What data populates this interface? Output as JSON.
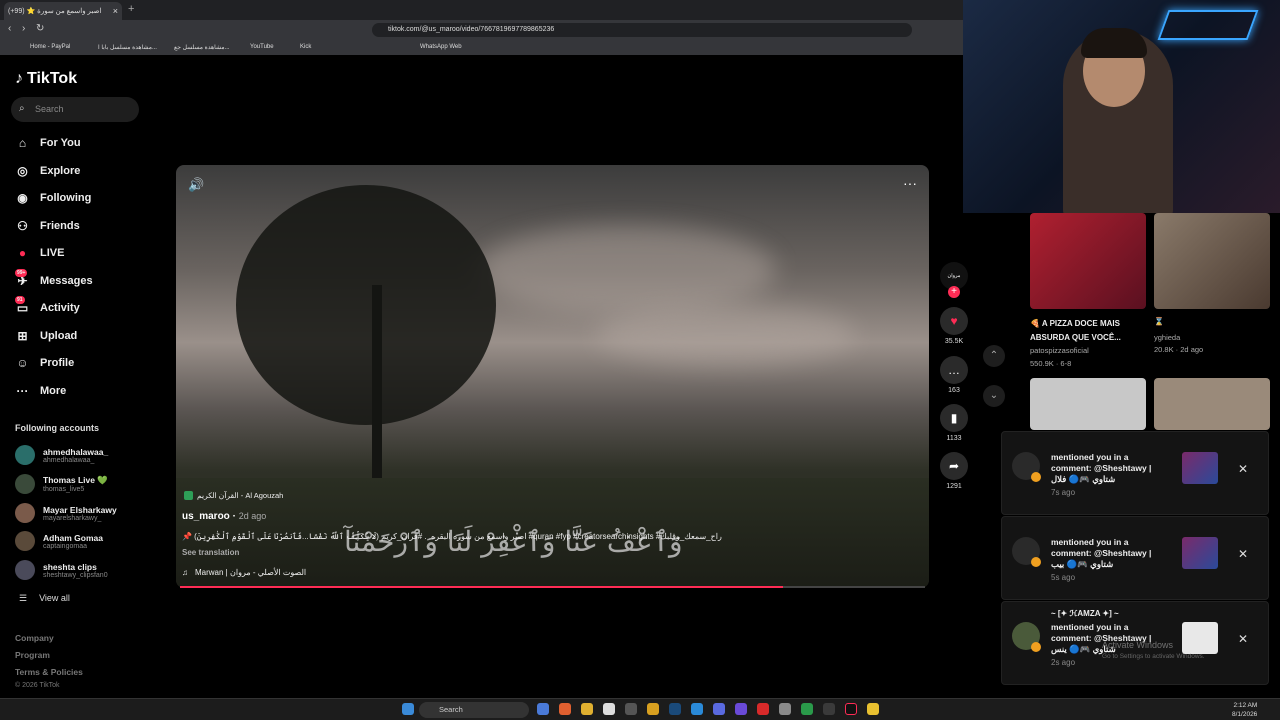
{
  "browser": {
    "tab_title": "اصبر واسمع من سورة ⭐ (99+)",
    "url": "tiktok.com/@us_maroo/video/7667819697789865236",
    "bookmarks": [
      "Home - PayPal",
      "مشاهدة مسلسل بابا ا...",
      "مشاهدة مسلسل جع...",
      "YouTube",
      "Kick",
      "WhatsApp Web"
    ]
  },
  "sidebar": {
    "logo": "TikTok",
    "search_placeholder": "Search",
    "nav": [
      {
        "label": "For You",
        "icon": "home-icon"
      },
      {
        "label": "Explore",
        "icon": "compass-icon"
      },
      {
        "label": "Following",
        "icon": "following-icon"
      },
      {
        "label": "Friends",
        "icon": "friends-icon"
      },
      {
        "label": "LIVE",
        "icon": "live-icon"
      },
      {
        "label": "Messages",
        "icon": "messages-icon",
        "badge": "99+"
      },
      {
        "label": "Activity",
        "icon": "activity-icon",
        "badge": "91"
      },
      {
        "label": "Upload",
        "icon": "upload-icon"
      },
      {
        "label": "Profile",
        "icon": "profile-icon"
      },
      {
        "label": "More",
        "icon": "more-icon"
      }
    ],
    "following_title": "Following accounts",
    "accounts": [
      {
        "name": "ahmedhalawaa_",
        "handle": "ahmedhalawaa_"
      },
      {
        "name": "Thomas Live 💚",
        "handle": "thomas_live5"
      },
      {
        "name": "Mayar Elsharkawy",
        "handle": "mayarelsharkawy_"
      },
      {
        "name": "Adham Gomaa",
        "handle": "captaingomaa"
      },
      {
        "name": "sheshta clips",
        "handle": "sheshtawy_clipsfan0"
      }
    ],
    "view_all": "View all",
    "footer": [
      "Company",
      "Program",
      "Terms & Policies"
    ],
    "copyright": "© 2026 TikTok"
  },
  "video": {
    "audio_tag": "القرآن الكريم - Al Agouzah",
    "verse_overlay": "وَٱعْفُ عَنَّا وَٱغْفِرْ لَنَا وَٱرْحَمْنَآ",
    "username": "us_maroo",
    "age": "2d ago",
    "caption": "📌 (لَا يُكَلِّفُ ٱللَّهُ نَفْسًا...فَٱنصُرْنَا عَلَى ٱلْقَوْمِ ٱلْكَٰفِرِينَ) اصبر واسمع من سوره البقره. . #قران_كريم #quran #fyp #creatorsearchinsights #راح_سمعك_وقلبك",
    "see_translation": "See translation",
    "music": "Marwan | الصوت الأصلي - مروان",
    "progress": 0.81
  },
  "actions": {
    "creator_label": "مروان",
    "likes": "35.5K",
    "comments": "163",
    "saves": "1133",
    "shares": "1291"
  },
  "grid": [
    {
      "title": "🍕 A PIZZA DOCE MAIS ABSURDA QUE VOCÊ...",
      "author": "patospizzasoficial",
      "stats": "550.9K · 6-8"
    },
    {
      "title": "⌛",
      "author": "yghieda",
      "stats": "20.8K · 2d ago"
    }
  ],
  "notifications": [
    {
      "text": "mentioned you in a comment: @Sheshtawy | شتاوي 🎮🔵 فلال",
      "time": "7s ago"
    },
    {
      "text": "mentioned you in a comment: @Sheshtawy | شتاوي 🎮🔵 بيب",
      "time": "5s ago"
    },
    {
      "sender": "~ [✦ ℋAMZA ✦] ~",
      "text": "mentioned you in a comment: @Sheshtawy | شتاوي 🎮🔵 ينس",
      "time": "2s ago"
    }
  ],
  "watermark": {
    "title": "Activate Windows",
    "sub": "Go to Settings to activate Windows."
  },
  "taskbar": {
    "search": "Search",
    "time": "2:12 AM",
    "date": "8/1/2026"
  }
}
